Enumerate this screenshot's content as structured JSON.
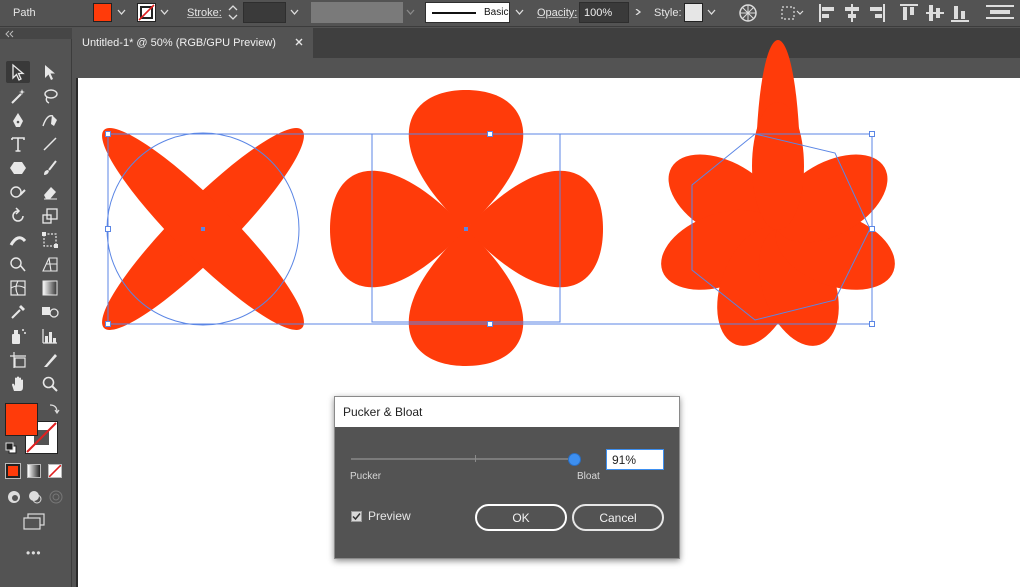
{
  "control_bar": {
    "selection_label": "Path",
    "stroke_label": "Stroke:",
    "stroke_weight": "",
    "brush_label": "Basic",
    "opacity_label": "Opacity:",
    "opacity_value": "100%",
    "style_label": "Style:"
  },
  "document": {
    "tab_title": "Untitled-1* @ 50% (RGB/GPU Preview)"
  },
  "colors": {
    "fill": "#ff3b0a",
    "selection": "#5b86e5",
    "ui_bg": "#535353"
  },
  "dialog": {
    "title": "Pucker & Bloat",
    "value": "91%",
    "value_fraction": 0.91,
    "pucker_label": "Pucker",
    "bloat_label": "Bloat",
    "preview_label": "Preview",
    "preview_checked": true,
    "ok_label": "OK",
    "cancel_label": "Cancel"
  },
  "toolbar": {
    "more_tools": "•••"
  }
}
